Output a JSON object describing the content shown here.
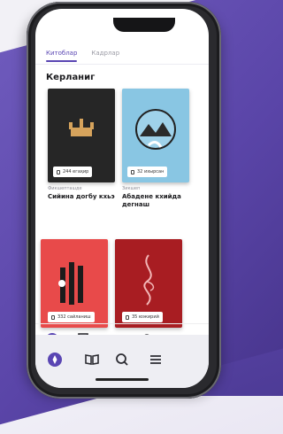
{
  "tabs": [
    {
      "label": "Китоблар"
    },
    {
      "label": "Кадрлар"
    }
  ],
  "section_title": "Керланиг",
  "books": [
    {
      "pages": "244 егаҳир",
      "meta": "Фикшепташде",
      "title": "Сийина догбу кхьэ"
    },
    {
      "pages": "32 ихырсан",
      "meta": "Зикшеп",
      "title": "Абадене кхийда дегнаш"
    },
    {
      "pages": "332 сайланиш"
    },
    {
      "pages": "35 юэкирий"
    }
  ],
  "nav": {
    "icons": [
      "compass-icon",
      "book-icon",
      "x-icon",
      "search-icon",
      "menu-icon"
    ]
  },
  "colors": {
    "accent": "#5a46b3",
    "card1": "#262626",
    "card2": "#89c6e3",
    "card3": "#e84a4a",
    "card4": "#a81d22"
  }
}
